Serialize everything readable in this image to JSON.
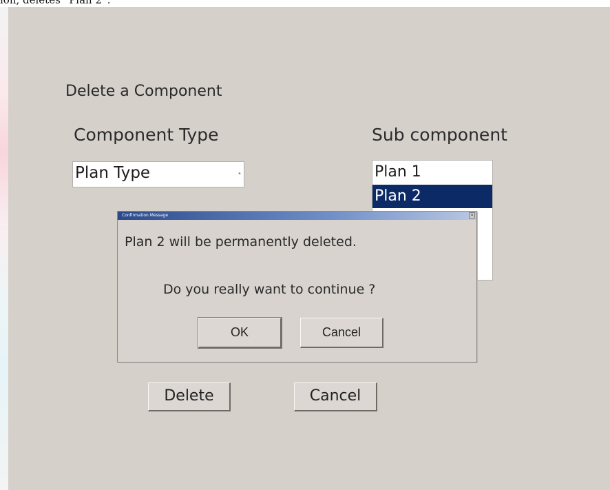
{
  "page_caption": "ion, deletes “Plan 2”.",
  "form": {
    "title": "Delete a Component",
    "component_type_label": "Component Type",
    "sub_component_label": "Sub component",
    "component_type_value": "Plan Type",
    "sub_components": [
      {
        "label": "Plan 1",
        "selected": false
      },
      {
        "label": "Plan 2",
        "selected": true
      }
    ],
    "delete_label": "Delete",
    "cancel_label": "Cancel"
  },
  "dialog": {
    "title": "Confirmation Message",
    "message": "Plan 2 will be permanently deleted.",
    "question": "Do you really want to continue ?",
    "ok_label": "OK",
    "cancel_label": "Cancel",
    "close_glyph": "×"
  },
  "colors": {
    "window_bg": "#d6d0cb",
    "selection_bg": "#0b2a66",
    "selection_text": "#ffffff"
  }
}
